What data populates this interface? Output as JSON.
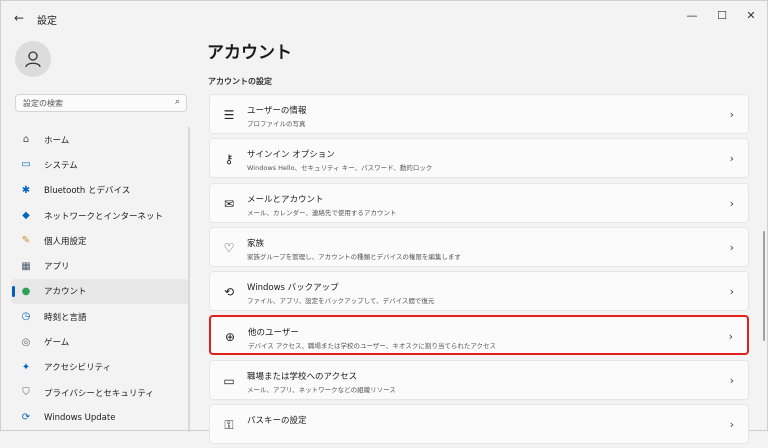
{
  "window": {
    "title": "設定",
    "back_icon": "back-arrow-icon"
  },
  "sidebar": {
    "search_placeholder": "設定の検索",
    "items": [
      {
        "label": "ホーム",
        "icon": "home-icon",
        "color": "#555555"
      },
      {
        "label": "システム",
        "icon": "system-icon",
        "color": "#0067c0"
      },
      {
        "label": "Bluetooth とデバイス",
        "icon": "bluetooth-icon",
        "color": "#0067c0"
      },
      {
        "label": "ネットワークとインターネット",
        "icon": "network-icon",
        "color": "#0067c0"
      },
      {
        "label": "個人用設定",
        "icon": "personalization-icon",
        "color": "#d08a2a"
      },
      {
        "label": "アプリ",
        "icon": "apps-icon",
        "color": "#4a5a70"
      },
      {
        "label": "アカウント",
        "icon": "accounts-icon",
        "color": "#2e9e5b",
        "active": true
      },
      {
        "label": "時刻と言語",
        "icon": "time-language-icon",
        "color": "#0067c0"
      },
      {
        "label": "ゲーム",
        "icon": "gaming-icon",
        "color": "#666666"
      },
      {
        "label": "アクセシビリティ",
        "icon": "accessibility-icon",
        "color": "#0067c0"
      },
      {
        "label": "プライバシーとセキュリティ",
        "icon": "privacy-shield-icon",
        "color": "#6b6b6b"
      },
      {
        "label": "Windows Update",
        "icon": "windows-update-icon",
        "color": "#0067c0"
      }
    ]
  },
  "main": {
    "title": "アカウント",
    "section": "アカウントの設定",
    "cards": [
      {
        "title": "ユーザーの情報",
        "subtitle": "プロファイルの写真",
        "icon": "user-info-icon"
      },
      {
        "title": "サインイン オプション",
        "subtitle": "Windows Hello、セキュリティ キー、パスワード、動的ロック",
        "icon": "key-icon"
      },
      {
        "title": "メールとアカウント",
        "subtitle": "メール、カレンダー、連絡先で使用するアカウント",
        "icon": "mail-icon"
      },
      {
        "title": "家族",
        "subtitle": "家族グループを管理し、アカウントの種類とデバイスの権限を編集します",
        "icon": "family-heart-icon"
      },
      {
        "title": "Windows バックアップ",
        "subtitle": "ファイル、アプリ、設定をバックアップして、デバイス間で復元",
        "icon": "backup-icon"
      },
      {
        "title": "他のユーザー",
        "subtitle": "デバイス アクセス、職場または学校のユーザー、キオスクに割り当てられたアクセス",
        "icon": "other-users-icon",
        "highlight": true
      },
      {
        "title": "職場または学校へのアクセス",
        "subtitle": "メール、アプリ、ネットワークなどの組織リソース",
        "icon": "briefcase-icon"
      },
      {
        "title": "パスキーの設定",
        "subtitle": "",
        "icon": "passkey-icon"
      }
    ]
  },
  "colors": {
    "accent": "#005fb8",
    "highlight_border": "#e0201b"
  }
}
